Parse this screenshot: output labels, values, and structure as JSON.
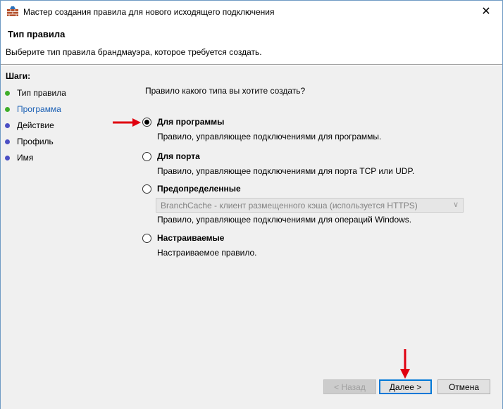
{
  "window": {
    "title": "Мастер создания правила для нового исходящего подключения",
    "close_glyph": "✕"
  },
  "header": {
    "title": "Тип правила",
    "description": "Выберите тип правила брандмауэра, которое требуется создать."
  },
  "steps": {
    "title": "Шаги:",
    "items": [
      {
        "label": "Тип правила",
        "color": "#3fae2a",
        "state": "done"
      },
      {
        "label": "Программа",
        "color": "#3fae2a",
        "state": "current"
      },
      {
        "label": "Действие",
        "color": "#4b4fc4",
        "state": "pending"
      },
      {
        "label": "Профиль",
        "color": "#4b4fc4",
        "state": "pending"
      },
      {
        "label": "Имя",
        "color": "#4b4fc4",
        "state": "pending"
      }
    ]
  },
  "main": {
    "question": "Правило какого типа вы хотите создать?",
    "options": [
      {
        "label": "Для программы",
        "description": "Правило, управляющее подключениями для программы.",
        "checked": true
      },
      {
        "label": "Для порта",
        "description": "Правило, управляющее подключениями для порта TCP или UDP.",
        "checked": false
      },
      {
        "label": "Предопределенные",
        "description": "Правило, управляющее подключениями для операций Windows.",
        "checked": false
      },
      {
        "label": "Настраиваемые",
        "description": "Настраиваемое правило.",
        "checked": false
      }
    ],
    "predefined_select": {
      "value": "BranchCache - клиент размещенного кэша (используется HTTPS)",
      "enabled": false
    }
  },
  "buttons": {
    "back": "< Назад",
    "next": "Далее >",
    "cancel": "Отмена"
  },
  "colors": {
    "accent": "#0078d7",
    "annotation_arrow": "#e0000f",
    "current_step": "#1a5fb4"
  }
}
